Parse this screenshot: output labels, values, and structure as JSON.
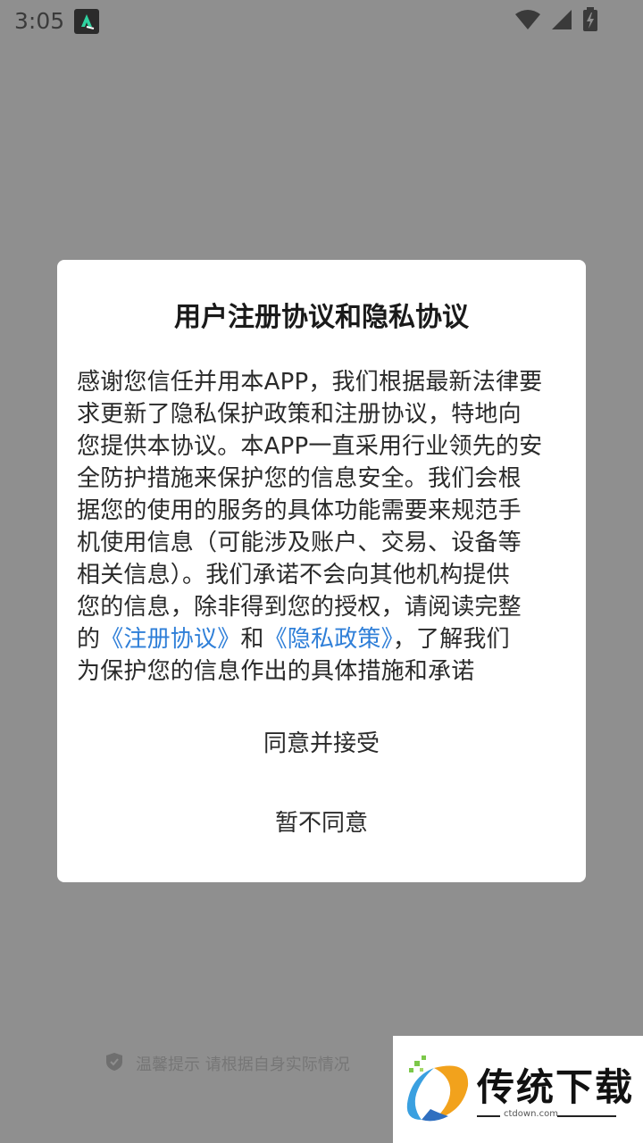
{
  "status_bar": {
    "time": "3:05",
    "icons": [
      "app-notification-icon",
      "wifi-icon",
      "signal-icon",
      "battery-icon"
    ]
  },
  "dialog": {
    "title": "用户注册协议和隐私协议",
    "body": {
      "line1": "感谢您信任并用本APP，我们根据最新法律要",
      "line2": "求更新了隐私保护政策和注册协议，特地向",
      "line3": "您提供本协议。本APP一直采用行业领先的安",
      "line4": "全防护措施来保护您的信息安全。我们会根",
      "line5": "据您的使用的服务的具体功能需要来规范手",
      "line6": "机使用信息（可能涉及账户、交易、设备等",
      "line7": "相关信息）。我们承诺不会向其他机构提供",
      "line8": "您的信息，除非得到您的授权，请阅读完整",
      "line9_pre": "的",
      "link_register": "《注册协议》",
      "line9_mid": "和",
      "link_privacy": "《隐私政策》",
      "line9_post": "，了解我们",
      "line10": "为保护您的信息作出的具体措施和承诺"
    },
    "agree_label": "同意并接受",
    "disagree_label": "暂不同意"
  },
  "bottom_tip": {
    "text": "温馨提示 请根据自身实际情况"
  },
  "watermark": {
    "brand": "传统下载",
    "url": "ctdown.com"
  },
  "colors": {
    "link": "#2f7fd8",
    "background": "#8f8f8f",
    "dialog": "#ffffff"
  }
}
